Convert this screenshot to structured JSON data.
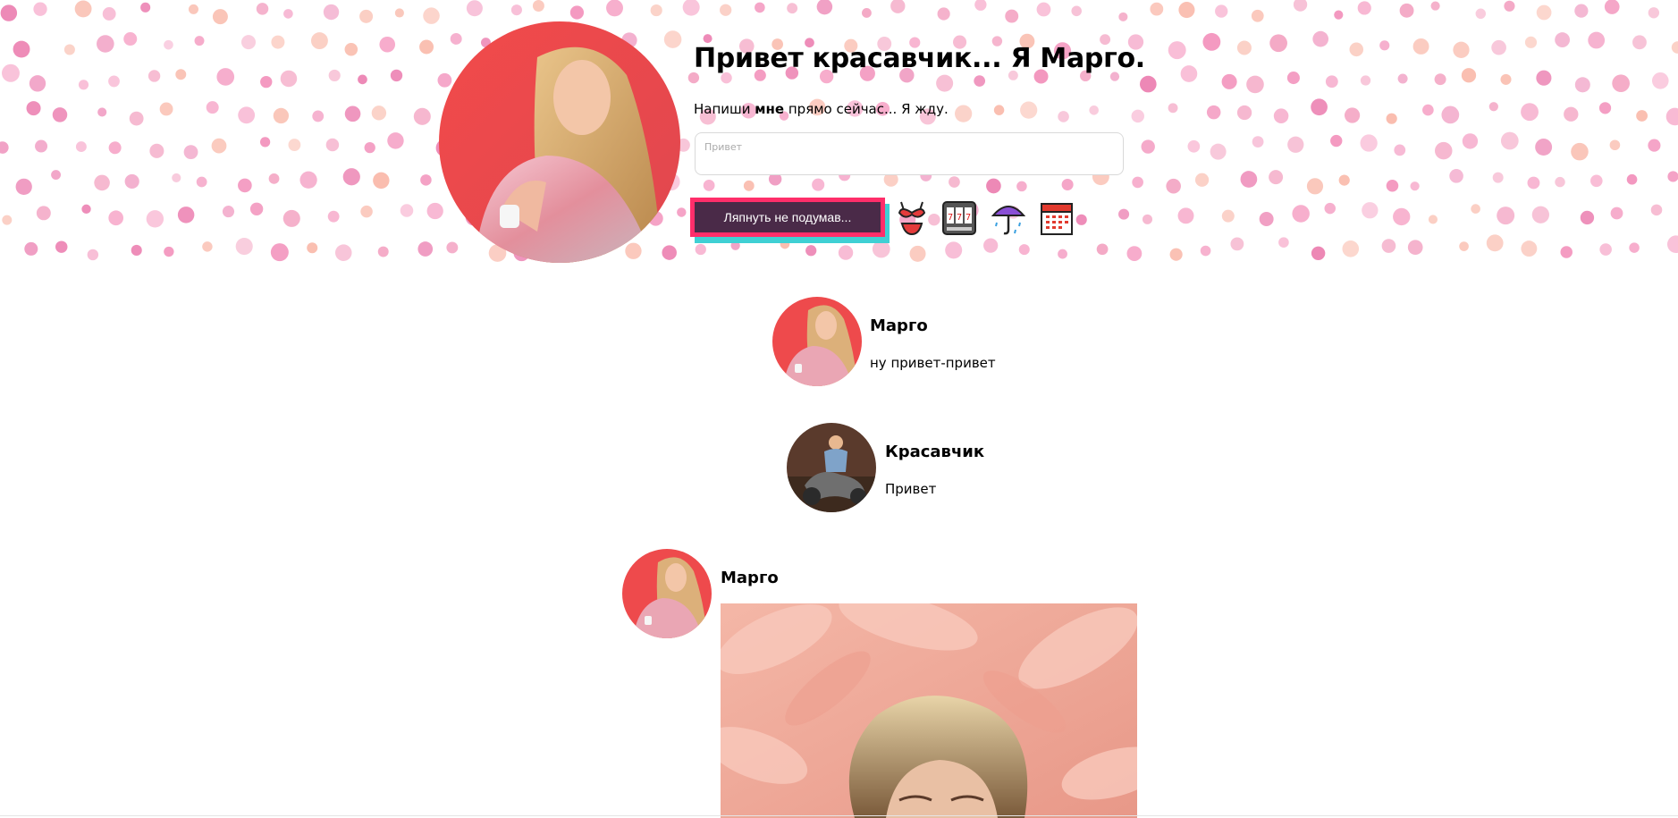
{
  "header": {
    "title": "Привет красавчик... Я Марго.",
    "subtitle_prefix": "Напиши ",
    "subtitle_bold": "мне",
    "subtitle_suffix": " прямо сейчас... Я жду.",
    "message_placeholder": "Привет",
    "send_label": "Ляпнуть не подумав...",
    "action_icons": [
      "bikini-icon",
      "slot-machine-icon",
      "umbrella-rain-icon",
      "calendar-icon"
    ],
    "colors": {
      "send_bg": "#4a2a48",
      "send_border": "#ff2e6a",
      "send_shadow": "#3fd0d4",
      "dots": "#f28cb8"
    }
  },
  "feed": {
    "posts": [
      {
        "author": "Марго",
        "text": "ну привет-привет"
      },
      {
        "author": "Красавчик",
        "text": "Привет"
      },
      {
        "author": "Марго"
      }
    ]
  }
}
